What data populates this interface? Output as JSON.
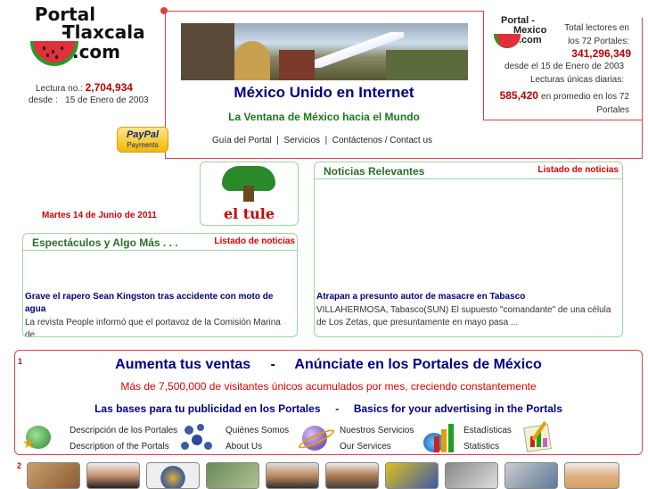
{
  "logo_left": {
    "line1": "Portal -",
    "line2": "Tlaxcala",
    "line3": ".com"
  },
  "readings": {
    "label": "Lectura no.:",
    "value": "2,704,934",
    "since_label": "desde :",
    "since_date": "15 de Enero de 2003"
  },
  "header": {
    "title": "México Unido en Internet",
    "subtitle": "La Ventana de México hacia el Mundo"
  },
  "logo_right": {
    "line1": "Portal -",
    "line2": "Mexico",
    "line3": ".com"
  },
  "totals": {
    "total_label": "Total lectores en los 72 Portales:",
    "total_value": "341,296,349",
    "total_since": "desde el 15 de Enero de 2003",
    "unique_label": "Lecturas únicas diarias:",
    "unique_value": "585,420",
    "unique_suffix": "en promedio en los 72 Portales"
  },
  "paypal": {
    "line1": "PayPal",
    "line2": "Payments"
  },
  "nav": {
    "guide": "Guía del Portal",
    "services": "Servicios",
    "contact": "Contáctenos / Contact us",
    "sep": "|"
  },
  "tule": {
    "label": "el tule"
  },
  "date": "Martes 14 de Junio de 2011",
  "noticias": {
    "title": "Noticias Relevantes",
    "list_link": "Listado de noticias",
    "headline": "Atrapan a presunto autor de masacre en Tabasco",
    "text": "VILLAHERMOSA, Tabasco(SUN) El supuesto \"comandante\" de una célula de Los Zetas, que presuntamente en mayo pasa ..."
  },
  "espectaculos": {
    "title": "Espectáculos y Algo Más . . .",
    "list_link": "Listado de noticias",
    "headline": "Grave el rapero Sean Kingston tras accidente con moto de agua",
    "text": "La revista People informó que el portavoz de la Comisión Marina de"
  },
  "ad": {
    "number": "1",
    "headline_left": "Aumenta tus ventas",
    "headline_sep": "-",
    "headline_right": "Anúnciate en los Portales de México",
    "sub": "Más de 7,500,000 de visitantes únicos acumulados por mes, creciendo constantemente",
    "bases_es": "Las bases para tu publicidad en los Portales",
    "bases_sep": "-",
    "bases_en": "Basics for your advertising in the Portals",
    "links": [
      {
        "es": "Descripción de los Portales",
        "en": "Description of the Portals"
      },
      {
        "es": "Quiénes Somos",
        "en": "About Us"
      },
      {
        "es": "Nuestros Servicios",
        "en": "Our Services"
      },
      {
        "es": "Estadísticas",
        "en": "Statistics"
      }
    ]
  },
  "row2": {
    "number": "2"
  },
  "colors": {
    "accent_red": "#e04040",
    "green_border": "#9fd59f",
    "navy": "#00008b"
  }
}
